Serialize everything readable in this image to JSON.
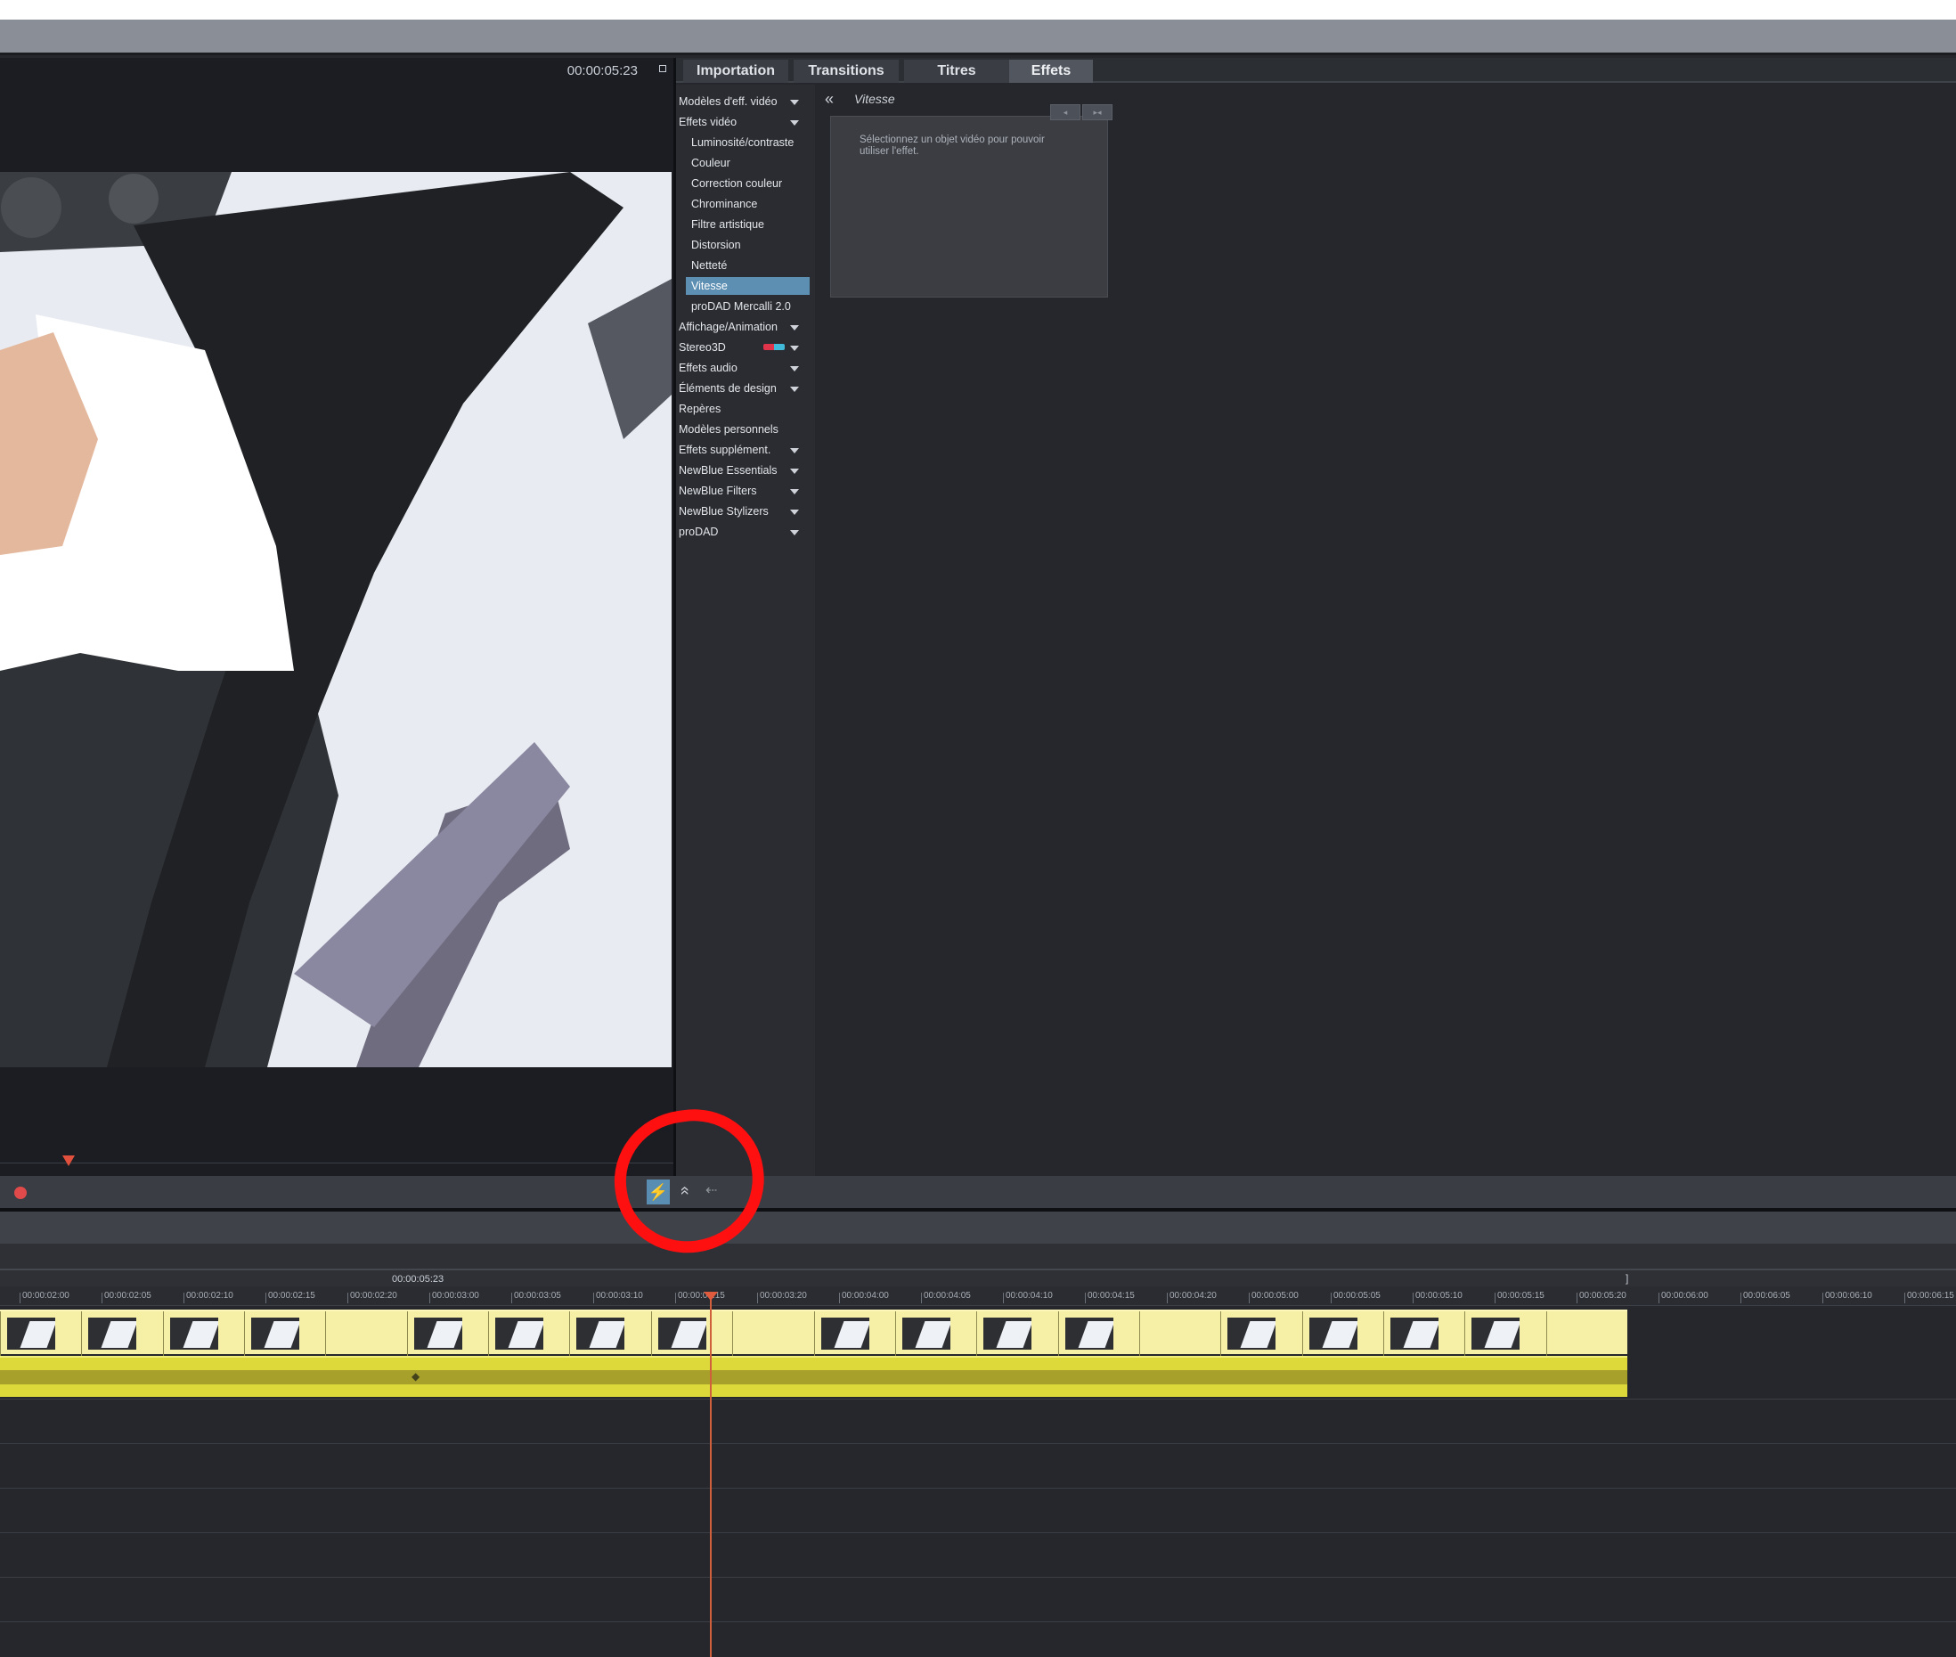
{
  "monitor": {
    "timecode": "00:00:05:23"
  },
  "tabs": [
    "Importation",
    "Transitions",
    "Titres",
    "Effets"
  ],
  "tree": [
    {
      "label": "Modèles d'eff. vidéo",
      "level": 0,
      "caret": true
    },
    {
      "label": "Effets vidéo",
      "level": 0,
      "caret": true
    },
    {
      "label": "Luminosité/contraste",
      "level": 1
    },
    {
      "label": "Couleur",
      "level": 1
    },
    {
      "label": "Correction couleur",
      "level": 1
    },
    {
      "label": "Chrominance",
      "level": 1
    },
    {
      "label": "Filtre artistique",
      "level": 1
    },
    {
      "label": "Distorsion",
      "level": 1
    },
    {
      "label": "Netteté",
      "level": 1
    },
    {
      "label": "Vitesse",
      "level": 1,
      "selected": true
    },
    {
      "label": "proDAD Mercalli 2.0",
      "level": 1
    },
    {
      "label": "Affichage/Animation",
      "level": 0,
      "caret": true
    },
    {
      "label": "Stereo3D",
      "level": 0,
      "caret": true,
      "badge": "stereo3d-glasses-icon"
    },
    {
      "label": "Effets audio",
      "level": 0,
      "caret": true
    },
    {
      "label": "Éléments de design",
      "level": 0,
      "caret": true
    },
    {
      "label": "Repères",
      "level": 0
    },
    {
      "label": "Modèles personnels",
      "level": 0
    },
    {
      "label": "Effets supplément.",
      "level": 0,
      "caret": true
    },
    {
      "label": "NewBlue Essentials",
      "level": 0,
      "caret": true
    },
    {
      "label": "NewBlue Filters",
      "level": 0,
      "caret": true
    },
    {
      "label": "NewBlue Stylizers",
      "level": 0,
      "caret": true
    },
    {
      "label": "proDAD",
      "level": 0,
      "caret": true
    }
  ],
  "effect": {
    "back_glyph": "«",
    "title": "Vitesse",
    "hint": "Sélectionnez un objet vidéo pour pouvoir utiliser l'effet."
  },
  "controls": {
    "lightning_glyph": "⚡",
    "expand_glyph": "«",
    "arrow_glyph": "⇠"
  },
  "timeline": {
    "position_label": "00:00:05:23",
    "end_marker": "]",
    "ruler": [
      "00:00:02:00",
      "00:00:02:05",
      "00:00:02:10",
      "00:00:02:15",
      "00:00:02:20",
      "00:00:03:00",
      "00:00:03:05",
      "00:00:03:10",
      "00:00:03:15",
      "00:00:03:20",
      "00:00:04:00",
      "00:00:04:05",
      "00:00:04:10",
      "00:00:04:15",
      "00:00:04:20",
      "00:00:05:00",
      "00:00:05:05",
      "00:00:05:10",
      "00:00:05:15",
      "00:00:05:20",
      "00:00:06:00",
      "00:00:06:05",
      "00:00:06:10",
      "00:00:06:15"
    ],
    "clip_count": 20
  },
  "colors": {
    "accent": "#5d8fb3",
    "video_clip": "#f5f0a6",
    "audio_clip": "#ded93a",
    "playhead": "#d0603c",
    "annotation": "#ff1010"
  }
}
